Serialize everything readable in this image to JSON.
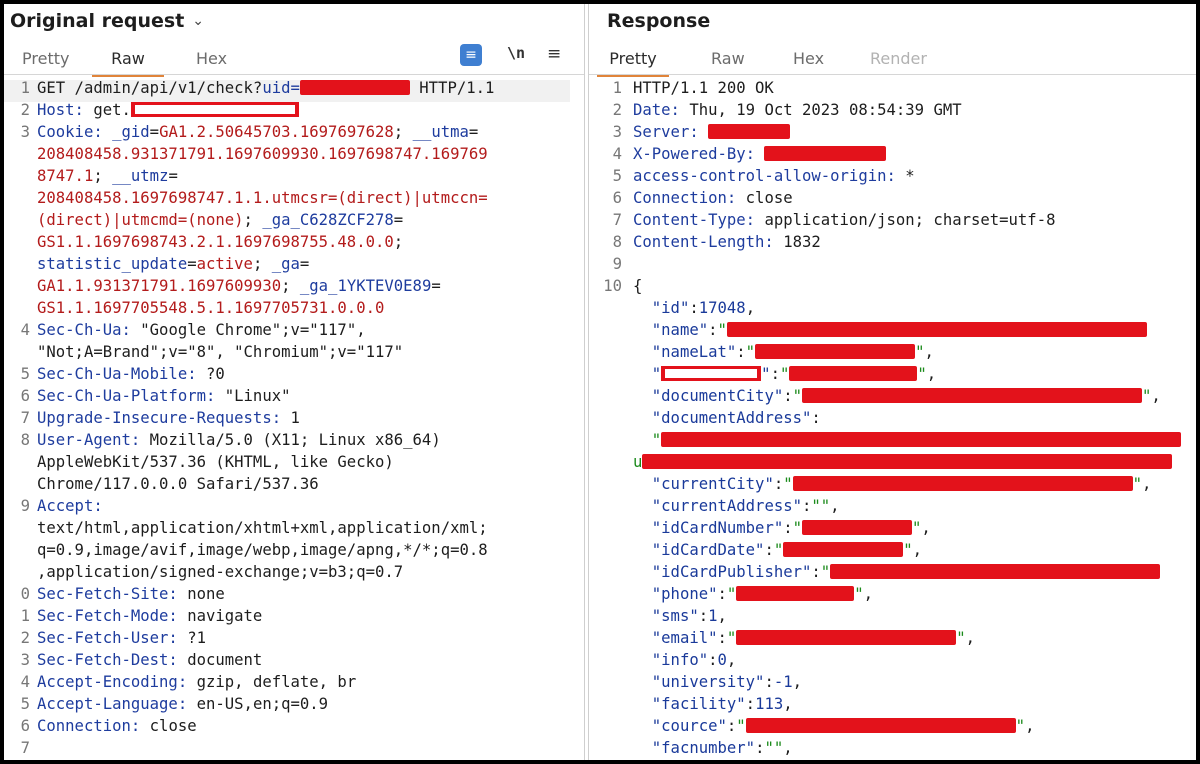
{
  "left_panel": {
    "title": "Original request",
    "tabs": [
      "Pretty",
      "Raw",
      "Hex"
    ],
    "active_tab": "Raw",
    "tools": {
      "wrap_icon": "word-wrap-icon",
      "newline_label": "\\n",
      "menu_icon": "hamburger-menu-icon"
    },
    "lines": [
      {
        "n": "1",
        "parts": [
          [
            "g",
            "GET /admin/api/v1/check?"
          ],
          [
            "k",
            "uid="
          ],
          [
            "redact",
            ""
          ],
          [
            "g",
            " HTTP/1.1"
          ]
        ]
      },
      {
        "n": "2",
        "parts": [
          [
            "k",
            "Host: "
          ],
          [
            "g",
            "get."
          ],
          [
            "redactw",
            ""
          ]
        ]
      },
      {
        "n": "3",
        "parts": [
          [
            "k",
            "Cookie: "
          ],
          [
            "k",
            "_gid"
          ],
          [
            "g",
            "="
          ],
          [
            "v",
            "GA1.2.50645703.1697697628"
          ],
          [
            "g",
            "; "
          ],
          [
            "k",
            "__utma"
          ],
          [
            "g",
            "="
          ]
        ]
      },
      {
        "n": "",
        "parts": [
          [
            "v",
            "208408458.931371791.1697609930.1697698747.169769"
          ]
        ]
      },
      {
        "n": "",
        "parts": [
          [
            "v",
            "8747.1"
          ],
          [
            "g",
            "; "
          ],
          [
            "k",
            "__utmz"
          ],
          [
            "g",
            "="
          ]
        ]
      },
      {
        "n": "",
        "parts": [
          [
            "v",
            "208408458.1697698747.1.1.utmcsr=(direct)|utmccn="
          ]
        ]
      },
      {
        "n": "",
        "parts": [
          [
            "v",
            "(direct)|utmcmd=(none)"
          ],
          [
            "g",
            "; "
          ],
          [
            "k",
            "_ga_C628ZCF278"
          ],
          [
            "g",
            "="
          ]
        ]
      },
      {
        "n": "",
        "parts": [
          [
            "v",
            "GS1.1.1697698743.2.1.1697698755.48.0.0"
          ],
          [
            "g",
            ";"
          ]
        ]
      },
      {
        "n": "",
        "parts": [
          [
            "k",
            "statistic_update"
          ],
          [
            "g",
            "="
          ],
          [
            "v",
            "active"
          ],
          [
            "g",
            "; "
          ],
          [
            "k",
            "_ga"
          ],
          [
            "g",
            "="
          ]
        ]
      },
      {
        "n": "",
        "parts": [
          [
            "v",
            "GA1.1.931371791.1697609930"
          ],
          [
            "g",
            "; "
          ],
          [
            "k",
            "_ga_1YKTEV0E89"
          ],
          [
            "g",
            "="
          ]
        ]
      },
      {
        "n": "",
        "parts": [
          [
            "v",
            "GS1.1.1697705548.5.1.1697705731.0.0.0"
          ]
        ]
      },
      {
        "n": "4",
        "parts": [
          [
            "k",
            "Sec-Ch-Ua: "
          ],
          [
            "g",
            "\"Google Chrome\";v=\"117\","
          ]
        ]
      },
      {
        "n": "",
        "parts": [
          [
            "g",
            "\"Not;A=Brand\";v=\"8\", \"Chromium\";v=\"117\""
          ]
        ]
      },
      {
        "n": "5",
        "parts": [
          [
            "k",
            "Sec-Ch-Ua-Mobile: "
          ],
          [
            "g",
            "?0"
          ]
        ]
      },
      {
        "n": "6",
        "parts": [
          [
            "k",
            "Sec-Ch-Ua-Platform: "
          ],
          [
            "g",
            "\"Linux\""
          ]
        ]
      },
      {
        "n": "7",
        "parts": [
          [
            "k",
            "Upgrade-Insecure-Requests: "
          ],
          [
            "g",
            "1"
          ]
        ]
      },
      {
        "n": "8",
        "parts": [
          [
            "k",
            "User-Agent: "
          ],
          [
            "g",
            "Mozilla/5.0 (X11; Linux x86_64)"
          ]
        ]
      },
      {
        "n": "",
        "parts": [
          [
            "g",
            "AppleWebKit/537.36 (KHTML, like Gecko)"
          ]
        ]
      },
      {
        "n": "",
        "parts": [
          [
            "g",
            "Chrome/117.0.0.0 Safari/537.36"
          ]
        ]
      },
      {
        "n": "9",
        "parts": [
          [
            "k",
            "Accept:"
          ]
        ]
      },
      {
        "n": "",
        "parts": [
          [
            "g",
            "text/html,application/xhtml+xml,application/xml;"
          ]
        ]
      },
      {
        "n": "",
        "parts": [
          [
            "g",
            "q=0.9,image/avif,image/webp,image/apng,*/*;q=0.8"
          ]
        ]
      },
      {
        "n": "",
        "parts": [
          [
            "g",
            ",application/signed-exchange;v=b3;q=0.7"
          ]
        ]
      },
      {
        "n": "0",
        "parts": [
          [
            "k",
            "Sec-Fetch-Site: "
          ],
          [
            "g",
            "none"
          ]
        ]
      },
      {
        "n": "1",
        "parts": [
          [
            "k",
            "Sec-Fetch-Mode: "
          ],
          [
            "g",
            "navigate"
          ]
        ]
      },
      {
        "n": "2",
        "parts": [
          [
            "k",
            "Sec-Fetch-User: "
          ],
          [
            "g",
            "?1"
          ]
        ]
      },
      {
        "n": "3",
        "parts": [
          [
            "k",
            "Sec-Fetch-Dest: "
          ],
          [
            "g",
            "document"
          ]
        ]
      },
      {
        "n": "4",
        "parts": [
          [
            "k",
            "Accept-Encoding: "
          ],
          [
            "g",
            "gzip, deflate, br"
          ]
        ]
      },
      {
        "n": "5",
        "parts": [
          [
            "k",
            "Accept-Language: "
          ],
          [
            "g",
            "en-US,en;q=0.9"
          ]
        ]
      },
      {
        "n": "6",
        "parts": [
          [
            "k",
            "Connection: "
          ],
          [
            "g",
            "close"
          ]
        ]
      },
      {
        "n": "7",
        "parts": []
      }
    ]
  },
  "right_panel": {
    "title": "Response",
    "tabs": [
      "Pretty",
      "Raw",
      "Hex",
      "Render"
    ],
    "active_tab": "Pretty",
    "disabled_tab": "Render",
    "lines": [
      {
        "n": "1",
        "parts": [
          [
            "g",
            "HTTP/1.1 200 OK"
          ]
        ]
      },
      {
        "n": "2",
        "parts": [
          [
            "k",
            "Date: "
          ],
          [
            "g",
            "Thu, 19 Oct 2023 08:54:39 GMT"
          ]
        ]
      },
      {
        "n": "3",
        "parts": [
          [
            "k",
            "Server: "
          ],
          [
            "redact",
            ""
          ]
        ]
      },
      {
        "n": "4",
        "parts": [
          [
            "k",
            "X-Powered-By: "
          ],
          [
            "redact",
            ""
          ]
        ]
      },
      {
        "n": "5",
        "parts": [
          [
            "k",
            "access-control-allow-origin: "
          ],
          [
            "g",
            "*"
          ]
        ]
      },
      {
        "n": "6",
        "parts": [
          [
            "k",
            "Connection: "
          ],
          [
            "g",
            "close"
          ]
        ]
      },
      {
        "n": "7",
        "parts": [
          [
            "k",
            "Content-Type: "
          ],
          [
            "g",
            "application/json; charset=utf-8"
          ]
        ]
      },
      {
        "n": "8",
        "parts": [
          [
            "k",
            "Content-Length: "
          ],
          [
            "g",
            "1832"
          ]
        ]
      },
      {
        "n": "9",
        "parts": []
      },
      {
        "n": "10",
        "parts": [
          [
            "g",
            "{"
          ]
        ]
      },
      {
        "n": "",
        "parts": [
          [
            "g",
            "  "
          ],
          [
            "jk",
            "\"id\""
          ],
          [
            "g",
            ":"
          ],
          [
            "jn",
            "17048"
          ],
          [
            "g",
            ","
          ]
        ]
      },
      {
        "n": "",
        "parts": [
          [
            "g",
            "  "
          ],
          [
            "jk",
            "\"name\""
          ],
          [
            "g",
            ":"
          ],
          [
            "js",
            "\""
          ],
          [
            "redact",
            ""
          ]
        ]
      },
      {
        "n": "",
        "parts": [
          [
            "g",
            "  "
          ],
          [
            "jk",
            "\"nameLat\""
          ],
          [
            "g",
            ":"
          ],
          [
            "js",
            "\""
          ],
          [
            "redact",
            ""
          ],
          [
            "js",
            "\""
          ],
          [
            "g",
            ","
          ]
        ]
      },
      {
        "n": "",
        "parts": [
          [
            "g",
            "  "
          ],
          [
            "jk",
            "\""
          ],
          [
            "redactw",
            ""
          ],
          [
            "jk",
            "\""
          ],
          [
            "g",
            ":"
          ],
          [
            "js",
            "\""
          ],
          [
            "redact",
            ""
          ],
          [
            "js",
            "\""
          ],
          [
            "g",
            ","
          ]
        ]
      },
      {
        "n": "",
        "parts": [
          [
            "g",
            "  "
          ],
          [
            "jk",
            "\"documentCity\""
          ],
          [
            "g",
            ":"
          ],
          [
            "js",
            "\""
          ],
          [
            "redact",
            ""
          ],
          [
            "js",
            "\""
          ],
          [
            "g",
            ","
          ]
        ]
      },
      {
        "n": "",
        "parts": [
          [
            "g",
            "  "
          ],
          [
            "jk",
            "\"documentAddress\""
          ],
          [
            "g",
            ":"
          ]
        ]
      },
      {
        "n": "",
        "parts": [
          [
            "g",
            "  "
          ],
          [
            "js",
            "\""
          ],
          [
            "redact",
            ""
          ]
        ]
      },
      {
        "n": "",
        "parts": [
          [
            "js",
            "u"
          ],
          [
            "redact",
            ""
          ]
        ]
      },
      {
        "n": "",
        "parts": [
          [
            "g",
            "  "
          ],
          [
            "jk",
            "\"currentCity\""
          ],
          [
            "g",
            ":"
          ],
          [
            "js",
            "\""
          ],
          [
            "redact",
            ""
          ],
          [
            "js",
            "\""
          ],
          [
            "g",
            ","
          ]
        ]
      },
      {
        "n": "",
        "parts": [
          [
            "g",
            "  "
          ],
          [
            "jk",
            "\"currentAddress\""
          ],
          [
            "g",
            ":"
          ],
          [
            "js",
            "\"\""
          ],
          [
            "g",
            ","
          ]
        ]
      },
      {
        "n": "",
        "parts": [
          [
            "g",
            "  "
          ],
          [
            "jk",
            "\"idCardNumber\""
          ],
          [
            "g",
            ":"
          ],
          [
            "js",
            "\""
          ],
          [
            "redact",
            ""
          ],
          [
            "js",
            "\""
          ],
          [
            "g",
            ","
          ]
        ]
      },
      {
        "n": "",
        "parts": [
          [
            "g",
            "  "
          ],
          [
            "jk",
            "\"idCardDate\""
          ],
          [
            "g",
            ":"
          ],
          [
            "js",
            "\""
          ],
          [
            "redact",
            ""
          ],
          [
            "js",
            "\""
          ],
          [
            "g",
            ","
          ]
        ]
      },
      {
        "n": "",
        "parts": [
          [
            "g",
            "  "
          ],
          [
            "jk",
            "\"idCardPublisher\""
          ],
          [
            "g",
            ":"
          ],
          [
            "js",
            "\""
          ],
          [
            "redact",
            ""
          ]
        ]
      },
      {
        "n": "",
        "parts": [
          [
            "g",
            "  "
          ],
          [
            "jk",
            "\"phone\""
          ],
          [
            "g",
            ":"
          ],
          [
            "js",
            "\""
          ],
          [
            "redact",
            ""
          ],
          [
            "js",
            "\""
          ],
          [
            "g",
            ","
          ]
        ]
      },
      {
        "n": "",
        "parts": [
          [
            "g",
            "  "
          ],
          [
            "jk",
            "\"sms\""
          ],
          [
            "g",
            ":"
          ],
          [
            "jn",
            "1"
          ],
          [
            "g",
            ","
          ]
        ]
      },
      {
        "n": "",
        "parts": [
          [
            "g",
            "  "
          ],
          [
            "jk",
            "\"email\""
          ],
          [
            "g",
            ":"
          ],
          [
            "js",
            "\""
          ],
          [
            "redact",
            ""
          ],
          [
            "js",
            "\""
          ],
          [
            "g",
            ","
          ]
        ]
      },
      {
        "n": "",
        "parts": [
          [
            "g",
            "  "
          ],
          [
            "jk",
            "\"info\""
          ],
          [
            "g",
            ":"
          ],
          [
            "jn",
            "0"
          ],
          [
            "g",
            ","
          ]
        ]
      },
      {
        "n": "",
        "parts": [
          [
            "g",
            "  "
          ],
          [
            "jk",
            "\"university\""
          ],
          [
            "g",
            ":"
          ],
          [
            "jn",
            "-1"
          ],
          [
            "g",
            ","
          ]
        ]
      },
      {
        "n": "",
        "parts": [
          [
            "g",
            "  "
          ],
          [
            "jk",
            "\"facility\""
          ],
          [
            "g",
            ":"
          ],
          [
            "jn",
            "113"
          ],
          [
            "g",
            ","
          ]
        ]
      },
      {
        "n": "",
        "parts": [
          [
            "g",
            "  "
          ],
          [
            "jk",
            "\"cource\""
          ],
          [
            "g",
            ":"
          ],
          [
            "js",
            "\""
          ],
          [
            "redact",
            ""
          ],
          [
            "js",
            "\""
          ],
          [
            "g",
            ","
          ]
        ]
      },
      {
        "n": "",
        "parts": [
          [
            "g",
            "  "
          ],
          [
            "jk",
            "\"facnumber\""
          ],
          [
            "g",
            ":"
          ],
          [
            "js",
            "\"\""
          ],
          [
            "g",
            ","
          ]
        ]
      }
    ]
  },
  "colors": {
    "accent_tab": "#e0843a",
    "redaction": "#e3121b",
    "header_key": "#1e3c9e",
    "cookie_value": "#b31b1b",
    "json_string": "#1a8a1a"
  }
}
